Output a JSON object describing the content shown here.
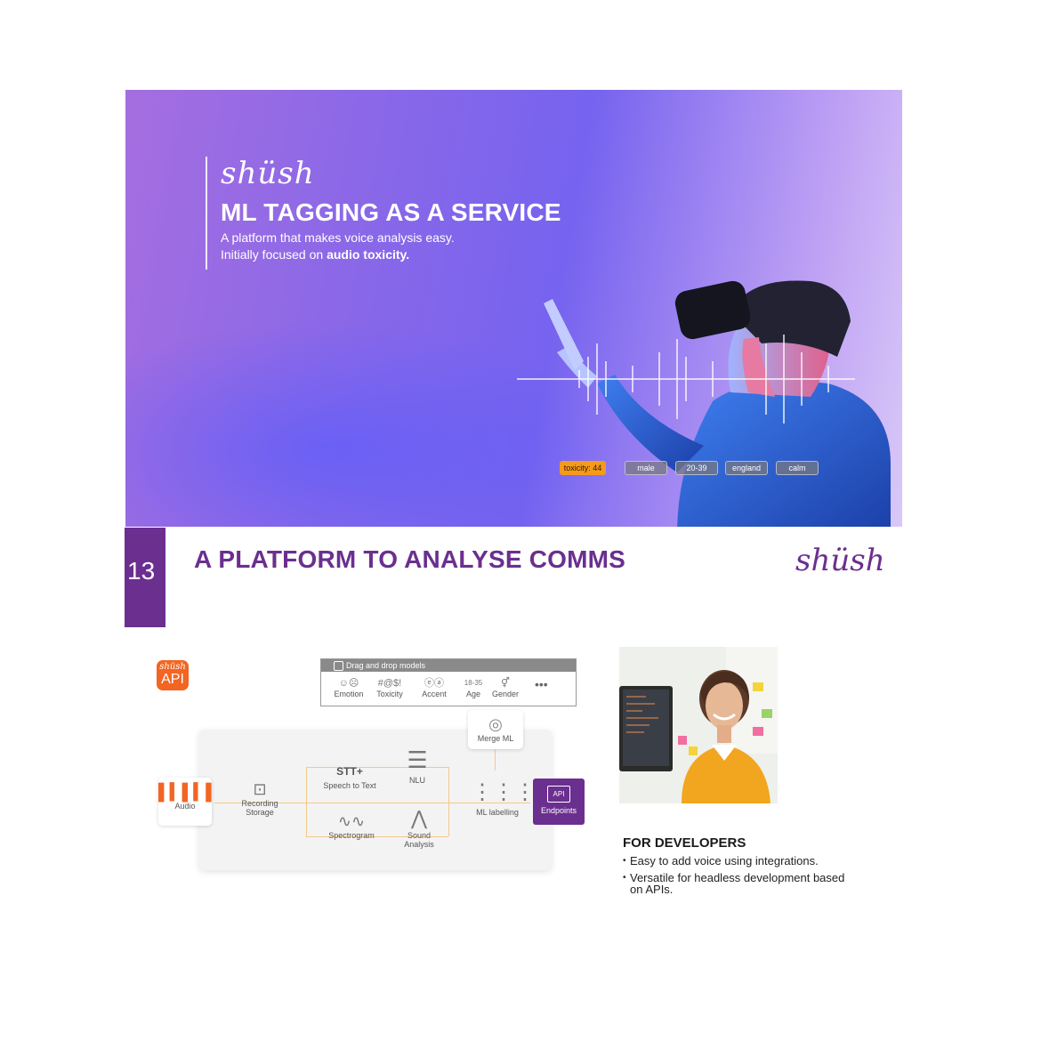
{
  "hero": {
    "logo": "shüsh",
    "title": "ML TAGGING AS A SERVICE",
    "subtitle_line1": "A platform that makes voice analysis easy.",
    "subtitle_line2_prefix": "Initially focused on ",
    "subtitle_line2_bold": "audio toxicity.",
    "tags": [
      "toxicity: 44",
      "male",
      "20-39",
      "england",
      "calm"
    ]
  },
  "header": {
    "slide_number": "13",
    "title": "A PLATFORM TO ANALYSE COMMS",
    "logo": "shüsh"
  },
  "api_badge": {
    "script": "shüsh",
    "label": "API"
  },
  "diagram": {
    "models_header": "Drag and drop models",
    "models": [
      {
        "icon": "☺☹",
        "label": "Emotion"
      },
      {
        "icon": "#@$!",
        "label": "Toxicity"
      },
      {
        "icon": "ⓔⓐ",
        "label": "Accent"
      },
      {
        "icon": "18-35",
        "label": "Age"
      },
      {
        "icon": "⚥",
        "label": "Gender"
      }
    ],
    "more": "•••",
    "merge": "Merge ML",
    "audio": "Audio",
    "recording_storage_l1": "Recording",
    "recording_storage_l2": "Storage",
    "stt": "STT+",
    "stt_label": "Speech to Text",
    "nlu": "NLU",
    "spectrogram": "Spectrogram",
    "sound_analysis_l1": "Sound",
    "sound_analysis_l2": "Analysis",
    "ml_labelling": "ML labelling",
    "endpoints": "Endpoints",
    "endpoints_icon": "API"
  },
  "developers": {
    "title": "FOR DEVELOPERS",
    "bullets": [
      "Easy to add voice using integrations.",
      "Versatile for headless development based on APIs."
    ]
  },
  "colors": {
    "brand_purple": "#6b2f8f",
    "api_orange": "#f26522",
    "toxicity_tag": "#f59a1b"
  }
}
